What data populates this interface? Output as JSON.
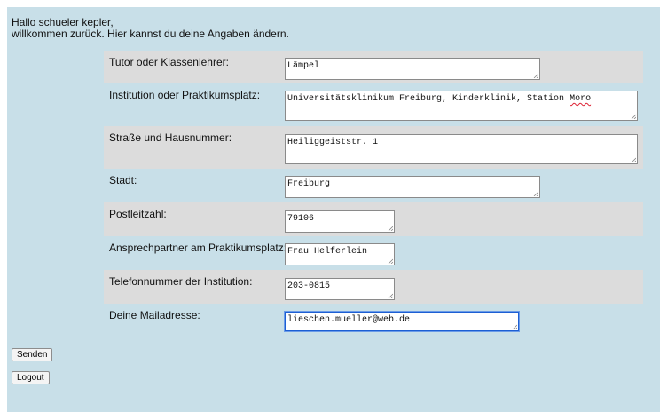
{
  "greeting": {
    "line1": "Hallo schueler kepler,",
    "line2": "willkommen zurück. Hier kannst du deine Angaben ändern."
  },
  "form": {
    "tutor": {
      "label": "Tutor oder Klassenlehrer:",
      "value": "Lämpel"
    },
    "institution": {
      "label": "Institution oder Praktikumsplatz:",
      "value_main": "Universitätsklinikum Freiburg, Kinderklinik, Station ",
      "value_flagged": "Moro"
    },
    "street": {
      "label": "Straße und Hausnummer:",
      "value": "Heiliggeiststr. 1"
    },
    "city": {
      "label": "Stadt:",
      "value": "Freiburg"
    },
    "zip": {
      "label": "Postleitzahl:",
      "value": "79106"
    },
    "contact": {
      "label": "Ansprechpartner am Praktikumsplatz:",
      "value": "Frau Helferlein"
    },
    "phone": {
      "label": "Telefonnummer der Institution:",
      "value": "203-0815"
    },
    "email": {
      "label": "Deine Mailadresse:",
      "value": "lieschen.mueller@web.de"
    }
  },
  "buttons": {
    "send": "Senden",
    "logout": "Logout"
  }
}
